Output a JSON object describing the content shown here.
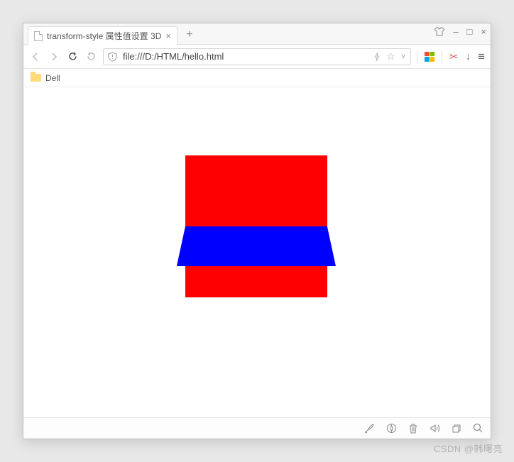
{
  "window": {
    "close": "×",
    "maximize": "□",
    "minimize": "–"
  },
  "tab": {
    "title": "transform-style 属性值设置 3D",
    "close": "×",
    "new": "+"
  },
  "nav": {
    "back": "‹",
    "forward": "›"
  },
  "address": {
    "url": "file:///D:/HTML/hello.html",
    "bolt": "⚡",
    "star": "☆",
    "dropdown": "∨"
  },
  "toolbar": {
    "scissors": "✂",
    "download": "↓",
    "menu": "≡"
  },
  "bookmarks": {
    "item1": "Dell"
  },
  "demo": {
    "red_color": "#ff0000",
    "blue_color": "#0000ff"
  },
  "status": {
    "rocket": "🚀",
    "compass": "➹",
    "trash": "🗑",
    "sound": "🕪",
    "restore": "❐",
    "search": "🔍"
  },
  "watermark": "CSDN @韩曙亮"
}
